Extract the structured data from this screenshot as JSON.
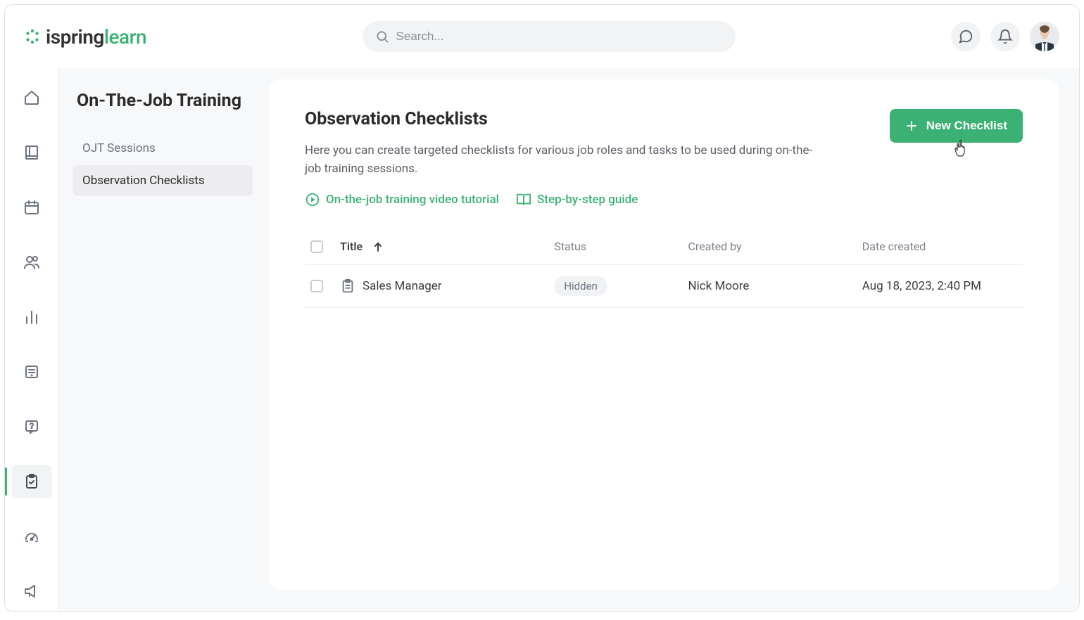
{
  "header": {
    "logo_ispring": "ispring",
    "logo_learn": "learn",
    "search_placeholder": "Search..."
  },
  "sidebar": {
    "title": "On-The-Job Training",
    "items": [
      {
        "label": "OJT Sessions"
      },
      {
        "label": "Observation Checklists"
      }
    ]
  },
  "main": {
    "heading": "Observation Checklists",
    "description": "Here you can create targeted checklists for various job roles and tasks to be used during on-the-job training sessions.",
    "new_button": "New Checklist",
    "link_video": "On-the-job training video tutorial",
    "link_guide": "Step-by-step guide",
    "columns": {
      "title": "Title",
      "status": "Status",
      "created_by": "Created by",
      "date_created": "Date created"
    },
    "rows": [
      {
        "title": "Sales Manager",
        "status": "Hidden",
        "created_by": "Nick Moore",
        "date_created": "Aug 18, 2023, 2:40 PM"
      }
    ]
  },
  "nav_icons": [
    "home",
    "library",
    "calendar",
    "users",
    "analytics",
    "news",
    "help",
    "checklist",
    "performance",
    "announcements"
  ],
  "colors": {
    "accent": "#3bb273"
  }
}
